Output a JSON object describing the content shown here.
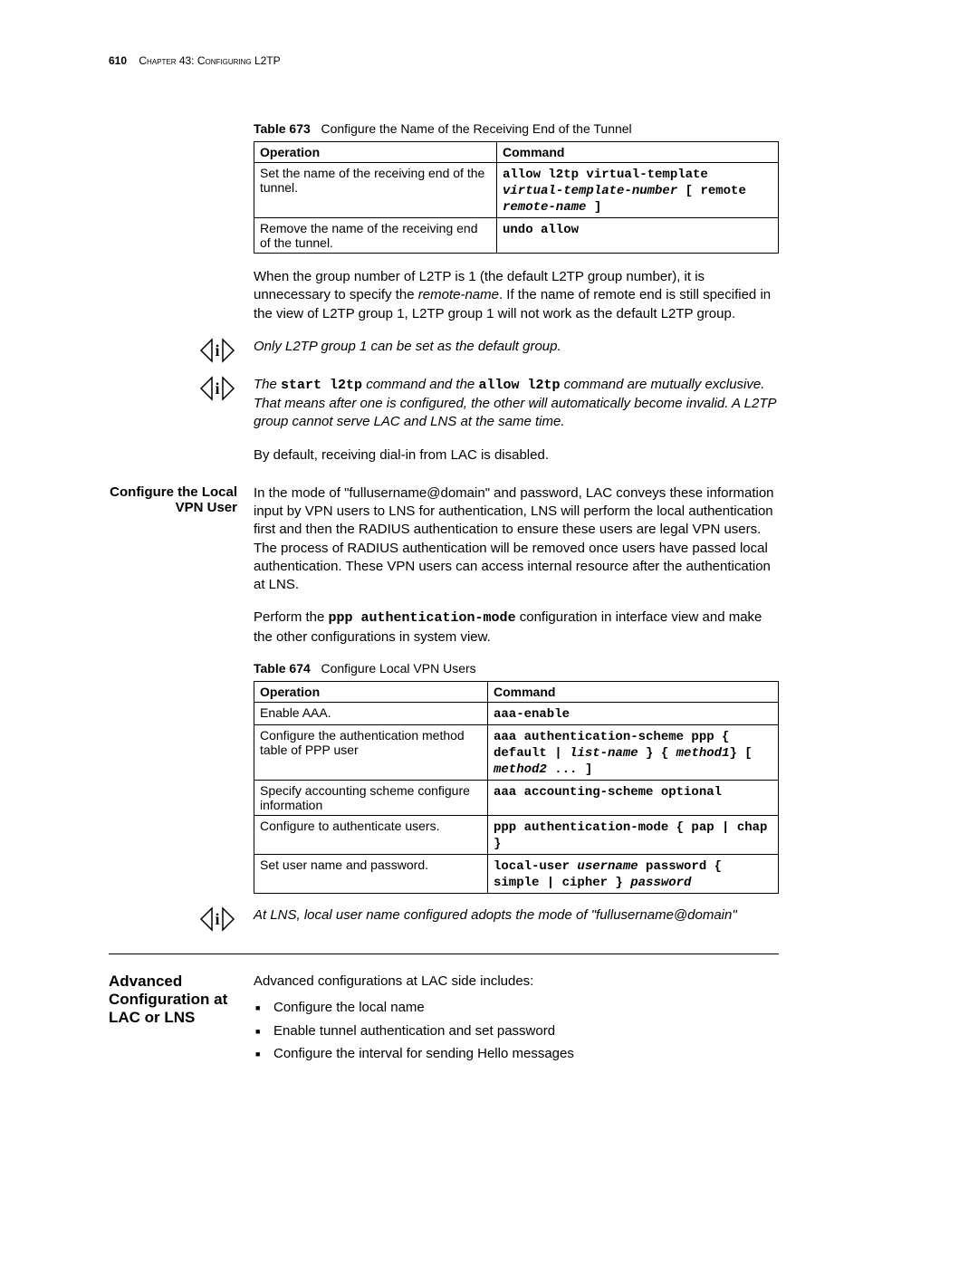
{
  "header": {
    "page_number": "610",
    "chapter_label": "Chapter 43: Configuring L2TP"
  },
  "table1": {
    "caption_label": "Table 673",
    "caption_text": "Configure the Name of the Receiving End of the Tunnel",
    "head_operation": "Operation",
    "head_command": "Command",
    "r1_op": "Set the name of the receiving end of the tunnel.",
    "r1_cmd_a": "allow l2tp virtual-template",
    "r1_cmd_b": "virtual-template-number",
    "r1_cmd_c": " [ remote ",
    "r1_cmd_d": "remote-name",
    "r1_cmd_e": " ]",
    "r2_op": "Remove the name of the receiving end of the tunnel.",
    "r2_cmd": "undo allow"
  },
  "para1_a": "When the group number of L2TP is 1 (the default L2TP group number), it is unnecessary to specify the ",
  "para1_b": "remote-name",
  "para1_c": ". If the name of remote end is still specified in the view of L2TP group 1, L2TP group 1 will not work as the default L2TP group.",
  "note1": "Only L2TP group 1 can be set as the default group.",
  "note2_a": "The ",
  "note2_b": "start l2tp",
  "note2_c": " command and the ",
  "note2_d": "allow l2tp",
  "note2_e": " command are mutually exclusive. That means after one is configured, the other will automatically become invalid. A L2TP group cannot serve LAC and LNS at the same time.",
  "para2": "By default, receiving dial-in from LAC is disabled.",
  "section1": {
    "title": "Configure the Local VPN User",
    "p1": "In the mode of \"fullusername@domain\" and password, LAC conveys these information input by VPN users to LNS for authentication, LNS will perform the local authentication first and then the RADIUS authentication to ensure these users are legal VPN users. The process of RADIUS authentication will be removed once users have passed local authentication. These VPN users can access internal resource after the authentication at LNS.",
    "p2_a": "Perform the ",
    "p2_b": "ppp authentication-mode",
    "p2_c": " configuration in interface view and make the other configurations in system view."
  },
  "table2": {
    "caption_label": "Table 674",
    "caption_text": "Configure Local VPN Users",
    "head_operation": "Operation",
    "head_command": "Command",
    "r1_op": "Enable AAA.",
    "r1_cmd": "aaa-enable",
    "r2_op": "Configure the authentication method table of PPP user",
    "r2_cmd_a": "aaa authentication-scheme ppp { default | ",
    "r2_cmd_b": "list-name",
    "r2_cmd_c": " } { ",
    "r2_cmd_d": "method1",
    "r2_cmd_e": "} [ ",
    "r2_cmd_f": "method2",
    "r2_cmd_g": " ... ]",
    "r3_op": "Specify accounting scheme configure information",
    "r3_cmd": "aaa accounting-scheme optional",
    "r4_op": "Configure to authenticate users.",
    "r4_cmd": "ppp authentication-mode { pap | chap }",
    "r5_op": "Set user name and password.",
    "r5_cmd_a": "local-user ",
    "r5_cmd_b": "username",
    "r5_cmd_c": " password { simple | cipher } ",
    "r5_cmd_d": "password"
  },
  "note3": "At LNS, local user name configured adopts the mode of \"fullusername@domain\"",
  "section2": {
    "title": "Advanced Configuration at LAC or LNS",
    "intro": "Advanced configurations at LAC side includes:",
    "b1": "Configure the local name",
    "b2": "Enable tunnel authentication and set password",
    "b3": "Configure the interval for sending Hello messages"
  }
}
